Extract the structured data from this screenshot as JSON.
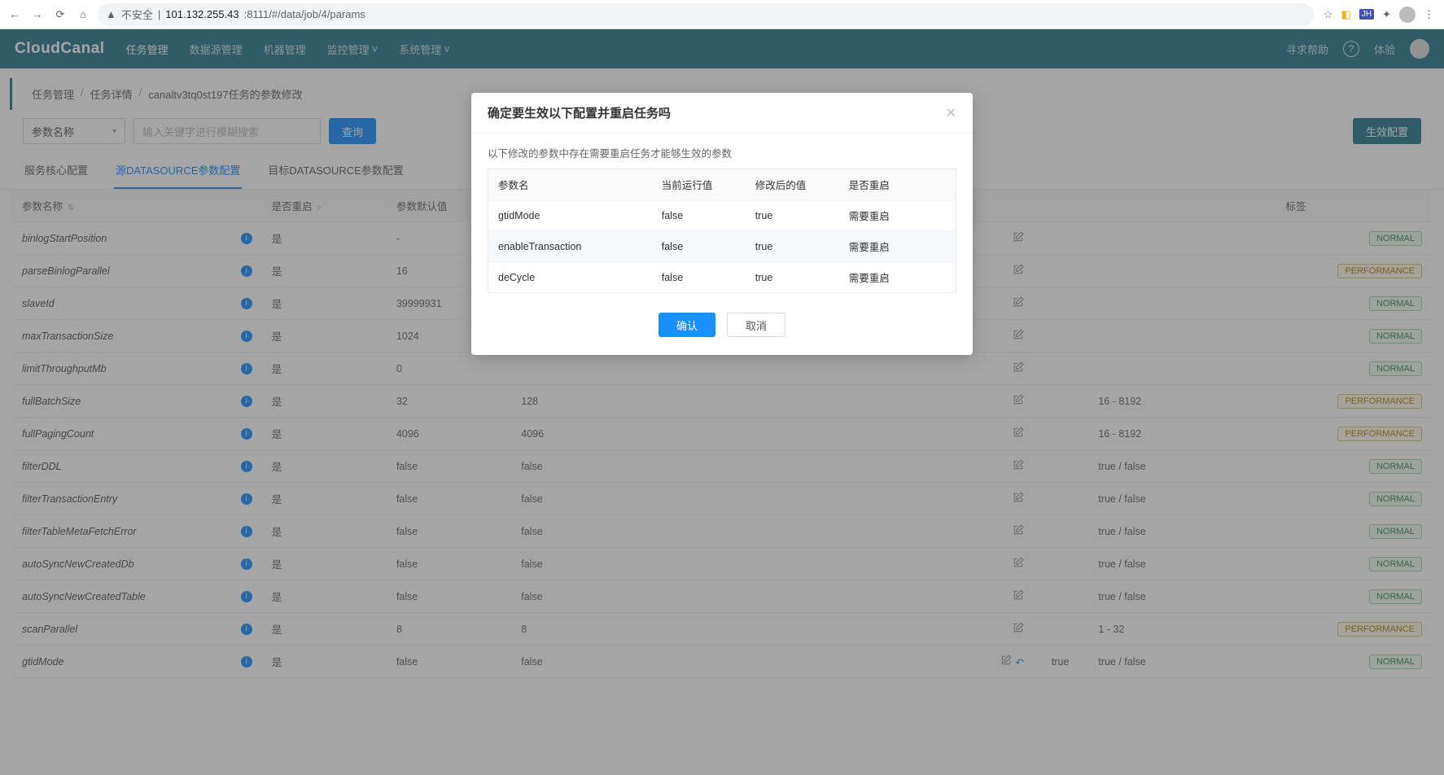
{
  "browser": {
    "insecure_label": "不安全",
    "url_host": "101.132.255.43",
    "url_rest": ":8111/#/data/job/4/params"
  },
  "header": {
    "logo": "CloudCanal",
    "nav": [
      "任务管理",
      "数据源管理",
      "机器管理",
      "监控管理",
      "系统管理"
    ],
    "nav_has_caret": [
      false,
      false,
      false,
      true,
      true
    ],
    "help": "寻求帮助",
    "experience": "体验"
  },
  "breadcrumb": {
    "items": [
      "任务管理",
      "任务详情",
      "canaltv3tq0st197任务的参数修改"
    ]
  },
  "toolbar": {
    "select_label": "参数名称",
    "search_placeholder": "输入关键字进行模糊搜索",
    "query_btn": "查询",
    "apply_btn": "生效配置"
  },
  "tabs": [
    "服务核心配置",
    "源DATASOURCE参数配置",
    "目标DATASOURCE参数配置"
  ],
  "tabs_active": 1,
  "columns": {
    "name": "参数名称",
    "restart": "是否重启",
    "default": "参数默认值",
    "current": "",
    "modified": "",
    "range": "",
    "label": "标签"
  },
  "rows": [
    {
      "name": "binlogStartPosition",
      "restart": "是",
      "default": "-",
      "current": "",
      "modified": "",
      "range": "",
      "tag": "NORMAL"
    },
    {
      "name": "parseBinlogParallel",
      "restart": "是",
      "default": "16",
      "current": "",
      "modified": "",
      "range": "",
      "tag": "PERFORMANCE"
    },
    {
      "name": "slaveId",
      "restart": "是",
      "default": "39999931",
      "current": "",
      "modified": "",
      "range": "",
      "tag": "NORMAL"
    },
    {
      "name": "maxTransactionSize",
      "restart": "是",
      "default": "1024",
      "current": "",
      "modified": "",
      "range": "",
      "tag": "NORMAL"
    },
    {
      "name": "limitThroughputMb",
      "restart": "是",
      "default": "0",
      "current": "",
      "modified": "",
      "range": "",
      "tag": "NORMAL"
    },
    {
      "name": "fullBatchSize",
      "restart": "是",
      "default": "32",
      "current": "128",
      "modified": "",
      "range": "16 - 8192",
      "tag": "PERFORMANCE"
    },
    {
      "name": "fullPagingCount",
      "restart": "是",
      "default": "4096",
      "current": "4096",
      "modified": "",
      "range": "16 - 8192",
      "tag": "PERFORMANCE"
    },
    {
      "name": "filterDDL",
      "restart": "是",
      "default": "false",
      "current": "false",
      "modified": "",
      "range": "true / false",
      "tag": "NORMAL"
    },
    {
      "name": "filterTransactionEntry",
      "restart": "是",
      "default": "false",
      "current": "false",
      "modified": "",
      "range": "true / false",
      "tag": "NORMAL"
    },
    {
      "name": "filterTableMetaFetchError",
      "restart": "是",
      "default": "false",
      "current": "false",
      "modified": "",
      "range": "true / false",
      "tag": "NORMAL"
    },
    {
      "name": "autoSyncNewCreatedDb",
      "restart": "是",
      "default": "false",
      "current": "false",
      "modified": "",
      "range": "true / false",
      "tag": "NORMAL"
    },
    {
      "name": "autoSyncNewCreatedTable",
      "restart": "是",
      "default": "false",
      "current": "false",
      "modified": "",
      "range": "true / false",
      "tag": "NORMAL"
    },
    {
      "name": "scanParallel",
      "restart": "是",
      "default": "8",
      "current": "8",
      "modified": "",
      "range": "1 - 32",
      "tag": "PERFORMANCE"
    },
    {
      "name": "gtidMode",
      "restart": "是",
      "default": "false",
      "current": "false",
      "modified": "true",
      "range": "true / false",
      "tag": "NORMAL",
      "undo": true
    }
  ],
  "modal": {
    "title": "确定要生效以下配置并重启任务吗",
    "hint": "以下修改的参数中存在需要重启任务才能够生效的参数",
    "cols": {
      "name": "参数名",
      "current": "当前运行值",
      "modified": "修改后的值",
      "restart": "是否重启"
    },
    "rows": [
      {
        "name": "gtidMode",
        "current": "false",
        "modified": "true",
        "restart": "需要重启"
      },
      {
        "name": "enableTransaction",
        "current": "false",
        "modified": "true",
        "restart": "需要重启"
      },
      {
        "name": "deCycle",
        "current": "false",
        "modified": "true",
        "restart": "需要重启"
      }
    ],
    "ok": "确认",
    "cancel": "取消"
  }
}
